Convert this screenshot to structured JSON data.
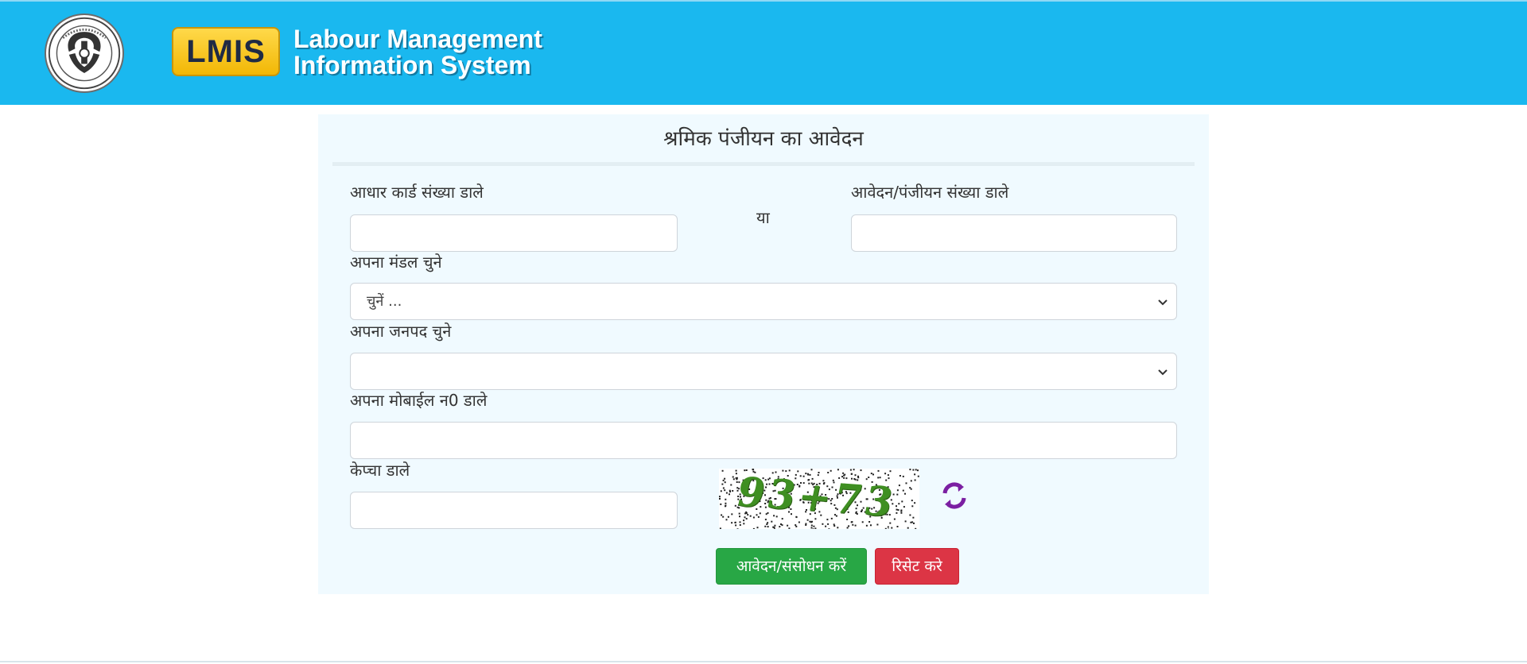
{
  "header": {
    "logo_badge": "LMIS",
    "title_line1": "Labour Management",
    "title_line2": "Information System",
    "emblem_icon": "up-government-emblem-icon"
  },
  "form": {
    "title": "श्रमिक पंजीयन का आवेदन",
    "aadhaar_label": "आधार कार्ड संख्या डाले",
    "aadhaar_value": "",
    "or_text": "या",
    "application_label": "आवेदन/पंजीयन संख्या डाले",
    "application_value": "",
    "division_label": "अपना मंडल चुने",
    "division_selected": "चुनें ...",
    "district_label": "अपना जनपद चुने",
    "district_selected": "",
    "mobile_label": "अपना मोबाईल न0 डाले",
    "mobile_value": "",
    "captcha_label": "केप्चा डाले",
    "captcha_value": "",
    "captcha_image_text": "93+73",
    "refresh_icon": "refresh-icon",
    "submit_label": "आवेदन/संसोधन करें",
    "reset_label": "रिसेट करे"
  },
  "colors": {
    "header_bg": "#1ab8ef",
    "panel_bg": "#f0faff",
    "submit_bg": "#28a745",
    "reset_bg": "#dc3545",
    "badge_bg": "#f2b705",
    "refresh_icon_color": "#7b1fa2"
  }
}
